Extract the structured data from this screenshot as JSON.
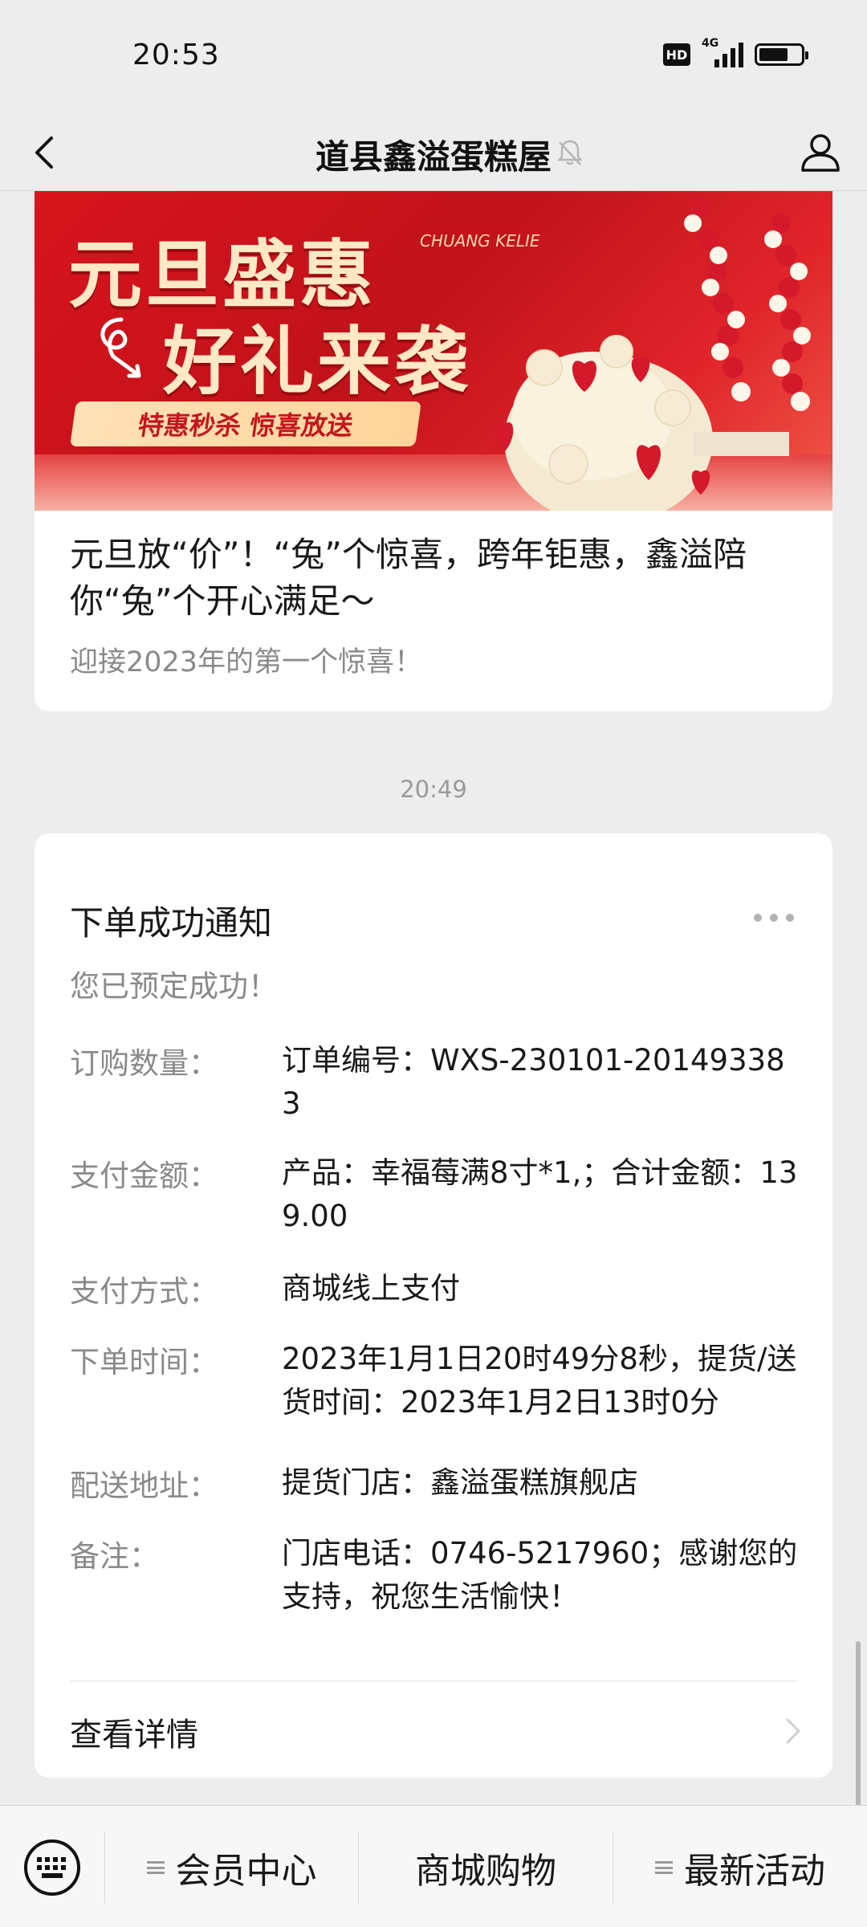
{
  "status_bar": {
    "time": "20:53",
    "hd": "HD",
    "network": "4G",
    "battery_level": 0.7
  },
  "nav": {
    "title": "道县鑫溢蛋糕屋",
    "icons": [
      "back-icon",
      "mute-bell-icon",
      "profile-icon"
    ]
  },
  "article": {
    "banner": {
      "line1": "元旦盛惠",
      "line2": "好礼来袭",
      "script_text": "CHUANG KELIE",
      "pill": "特惠秒杀 惊喜放送"
    },
    "title": "元旦放“价”！“兔”个惊喜，跨年钜惠，鑫溢陪你“兔”个开心满足～",
    "description": "迎接2023年的第一个惊喜！"
  },
  "timestamp": "20:49",
  "notice": {
    "title": "下单成功通知",
    "subtitle": "您已预定成功！",
    "fields": [
      {
        "label": "订购数量：",
        "value": "订单编号：WXS-230101-201493383"
      },
      {
        "label": "支付金额：",
        "value": "产品：幸福莓满8寸*1,；合计金额：139.00"
      },
      {
        "label": "支付方式：",
        "value": "商城线上支付"
      },
      {
        "label": "下单时间：",
        "value": "2023年1月1日20时49分8秒，提货/送货时间：2023年1月2日13时0分"
      },
      {
        "label": "配送地址：",
        "value": "提货门店：鑫溢蛋糕旗舰店"
      },
      {
        "label": "备注：",
        "value": "门店电话：0746-5217960；感谢您的支持，祝您生活愉快！"
      }
    ],
    "details_link": "查看详情"
  },
  "bottom_menu": {
    "items": [
      {
        "label": "会员中心",
        "has_submenu": true
      },
      {
        "label": "商城购物",
        "has_submenu": false
      },
      {
        "label": "最新活动",
        "has_submenu": true
      }
    ]
  }
}
